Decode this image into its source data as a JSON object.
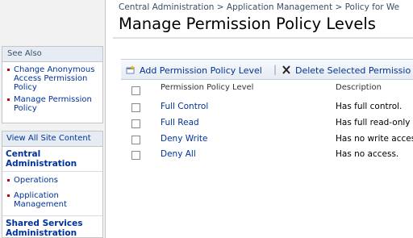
{
  "breadcrumb": {
    "item1": "Central Administration",
    "sep1": ">",
    "item2": "Application Management",
    "sep2": ">",
    "item3": "Policy for We"
  },
  "page": {
    "title": "Manage Permission Policy Levels"
  },
  "sidebar": {
    "see_also": {
      "title": "See Also",
      "items": [
        "Change Anonymous Access Permission Policy",
        "Manage Permission Policy"
      ]
    },
    "view_all": "View All Site Content",
    "central_admin": {
      "title": "Central Administration",
      "items": [
        "Operations",
        "Application Management"
      ]
    },
    "shared_services": {
      "title": "Shared Services Administration"
    }
  },
  "toolbar": {
    "add_label": "Add Permission Policy Level",
    "separator": "|",
    "delete_label": "Delete Selected Permissio"
  },
  "table": {
    "headers": {
      "level": "Permission Policy Level",
      "description": "Description"
    },
    "rows": [
      {
        "level": "Full Control",
        "description": "Has full control."
      },
      {
        "level": "Full Read",
        "description": "Has full read-only ac"
      },
      {
        "level": "Deny Write",
        "description": "Has no write access."
      },
      {
        "level": "Deny All",
        "description": "Has no access."
      }
    ]
  },
  "colors": {
    "link": "#003399",
    "accent": "#c00000",
    "nav_header": "#e6ecf3"
  },
  "icons": {
    "add": "add-item-icon",
    "delete": "delete-x-icon"
  }
}
